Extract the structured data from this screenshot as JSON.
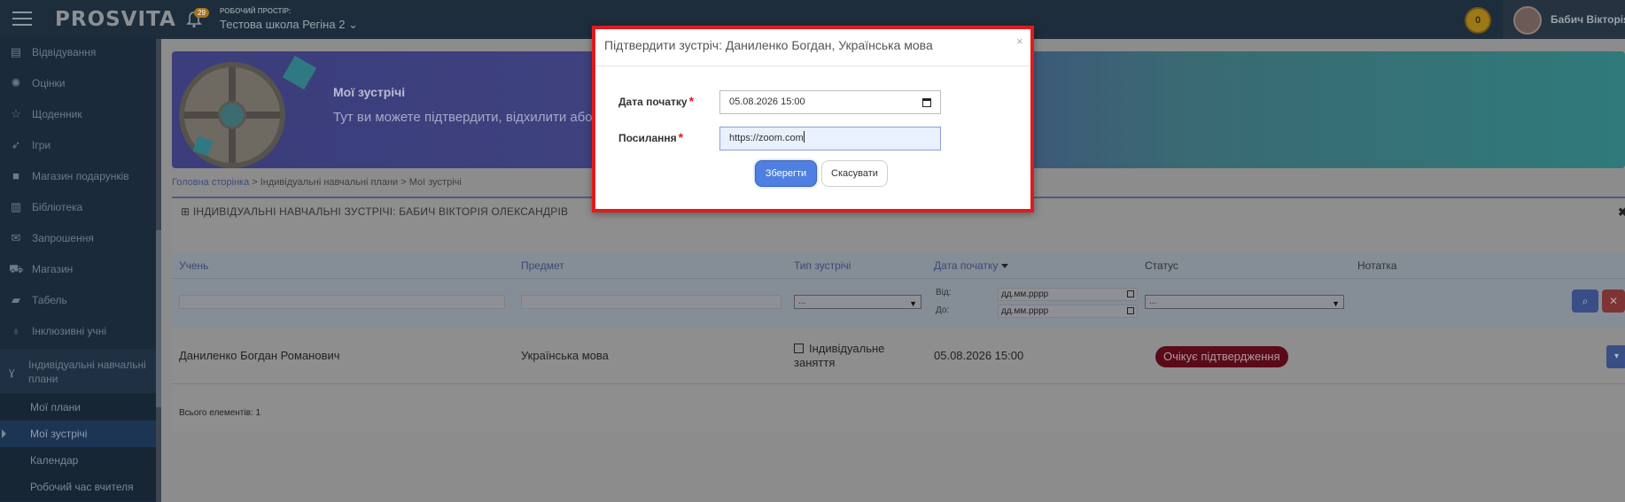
{
  "topbar": {
    "logo": "PROSVITA",
    "notifications_count": "29",
    "workspace_label": "РОБОЧИЙ ПРОСТІР:",
    "workspace_name": "Тестова школа Регіна 2",
    "coins": "0",
    "user_name": "Бабич Вікторія"
  },
  "sidebar": {
    "items": [
      {
        "label": "Відвідування",
        "icon": "attendance-icon"
      },
      {
        "label": "Оцінки",
        "icon": "grades-icon"
      },
      {
        "label": "Щоденник",
        "icon": "star-icon"
      },
      {
        "label": "Ігри",
        "icon": "rocket-icon"
      },
      {
        "label": "Магазин подарунків",
        "icon": "gift-icon"
      },
      {
        "label": "Бібліотека",
        "icon": "book-icon"
      },
      {
        "label": "Запрошення",
        "icon": "envelope-icon"
      },
      {
        "label": "Магазин",
        "icon": "cart-icon"
      },
      {
        "label": "Табель",
        "icon": "folder-icon"
      },
      {
        "label": "Інклюзивні учні",
        "icon": "stethoscope-icon"
      }
    ],
    "group_label": "Індивідуальні навчальні плани",
    "sub_items": [
      {
        "label": "Мої плани"
      },
      {
        "label": "Мої зустрічі"
      },
      {
        "label": "Календар"
      },
      {
        "label": "Робочий час вчителя"
      }
    ]
  },
  "banner": {
    "title": "Мої зустрічі",
    "subtitle": "Тут ви можете підтвердити, відхилити або"
  },
  "breadcrumb": {
    "home": "Головна сторінка",
    "rest": " > Індивідуальні навчальні плани > Мої зустрічі"
  },
  "panel": {
    "title": "ІНДИВІДУАЛЬНІ НАВЧАЛЬНІ ЗУСТРІЧІ: БАБИЧ ВІКТОРІЯ ОЛЕКСАНДРІВ",
    "columns": [
      "Учень",
      "Предмет",
      "Тип зустрічі",
      "Дата початку",
      "Статус",
      "Нотатка"
    ],
    "filters": {
      "type_select": "...",
      "status_select": "...",
      "from_label": "Від:",
      "to_label": "До:",
      "date_placeholder": "дд.мм.рррр"
    },
    "rows": [
      {
        "student": "Даниленко Богдан Романович",
        "subject": "Українська мова",
        "type_line1": "Індивідуальне",
        "type_line2": "заняття",
        "start": "05.08.2026 15:00",
        "status": "Очікує підтвердження"
      }
    ],
    "total": "Всього елементів: 1"
  },
  "modal": {
    "title": "Підтвердити зустріч: Даниленко Богдан, Українська мова",
    "start_label": "Дата початку",
    "start_value": "05.08.2026 15:00",
    "link_label": "Посилання",
    "link_value": "https://zoom.com",
    "save_label": "Зберегти",
    "cancel_label": "Скасувати",
    "required_mark": "*"
  }
}
